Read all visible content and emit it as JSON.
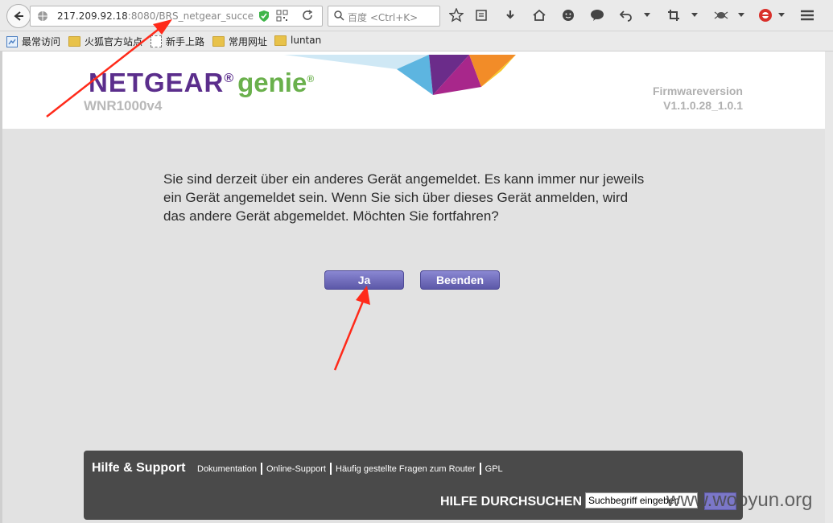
{
  "browser": {
    "url_host": "217.209.92.18",
    "url_rest": ":8080/BRS_netgear_succe",
    "search_placeholder": "百度 <Ctrl+K>"
  },
  "bookmarks": [
    {
      "label": "最常访问"
    },
    {
      "label": "火狐官方站点"
    },
    {
      "label": "新手上路"
    },
    {
      "label": "常用网址"
    },
    {
      "label": "luntan"
    }
  ],
  "header": {
    "brand": "NETGEAR",
    "trademark": "®",
    "product": "genie",
    "model": "WNR1000v4",
    "firmware_label": "Firmwareversion",
    "firmware_version": "V1.1.0.28_1.0.1"
  },
  "dialog": {
    "message": "Sie sind derzeit über ein anderes Gerät angemeldet. Es kann immer nur jeweils ein Gerät angemeldet sein. Wenn Sie sich über dieses Gerät anmelden, wird das andere Gerät abgemeldet. Möchten Sie fortfahren?",
    "yes_label": "Ja",
    "quit_label": "Beenden"
  },
  "footer": {
    "title": "Hilfe & Support",
    "links": [
      "Dokumentation",
      "Online-Support",
      "Häufig gestellte Fragen zum Router",
      "GPL"
    ],
    "search_title": "HILFE DURCHSUCHEN",
    "search_value": "Suchbegriff eingeben"
  },
  "watermark": "www.wooyun.org",
  "colors": {
    "brand_purple": "#5b2e8c",
    "genie_green": "#6ab04c",
    "button_purple": "#6e6ab9",
    "annotation_red": "#ff2a1a"
  }
}
